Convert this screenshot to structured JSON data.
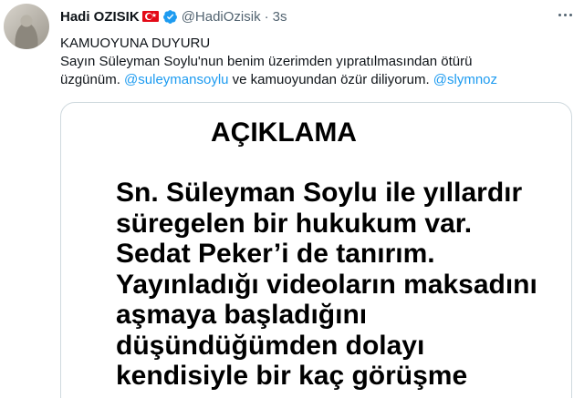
{
  "tweet": {
    "author_name": "Hadi OZISIK",
    "handle": "@HadiOzisik",
    "separator": "·",
    "time": "3s",
    "text_line1": "KAMUOYUNA DUYURU",
    "text_line2": "Sayın Süleyman Soylu'nun benim üzerimden yıpratılmasından ötürü",
    "text_line3_a": "üzgünüm. ",
    "mention1": "@suleymansoylu",
    "text_line3_b": " ve kamuoyundan özür diliyorum. ",
    "mention2": "@slymnoz"
  },
  "media": {
    "title": "AÇIKLAMA",
    "lines": [
      "Sn. Süleyman Soylu ile yıllardır",
      "süregelen bir hukukum var.",
      "Sedat Peker’i de tanırım.",
      "Yayınladığı videoların maksadını",
      "aşmaya başladığını",
      "düşündüğümden dolayı",
      "kendisiyle bir kaç görüşme"
    ]
  },
  "colors": {
    "accent": "#1d9bf0",
    "secondary_text": "#536471",
    "flag_red": "#e30a17"
  },
  "icons": [
    "avatar",
    "turkey-flag-icon",
    "verified-badge-icon",
    "more-options-icon"
  ]
}
